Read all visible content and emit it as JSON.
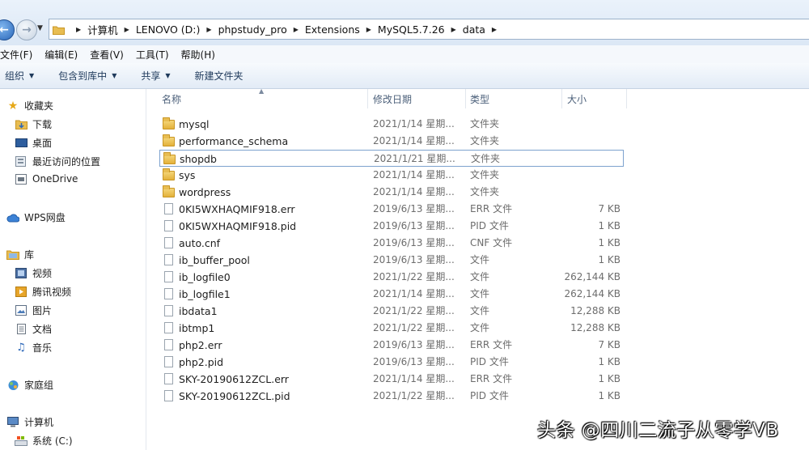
{
  "address": {
    "crumbs": [
      "计算机",
      "LENOVO (D:)",
      "phpstudy_pro",
      "Extensions",
      "MySQL5.7.26",
      "data"
    ]
  },
  "menu": [
    "文件(F)",
    "编辑(E)",
    "查看(V)",
    "工具(T)",
    "帮助(H)"
  ],
  "toolbar": {
    "organize": "组织",
    "include_in_library": "包含到库中",
    "share": "共享",
    "new_folder": "新建文件夹"
  },
  "nav": {
    "favorites": "收藏夹",
    "downloads": "下载",
    "desktop": "桌面",
    "recent": "最近访问的位置",
    "onedrive": "OneDrive",
    "wps": "WPS网盘",
    "libraries": "库",
    "videos": "视频",
    "tencent_video": "腾讯视频",
    "pictures": "图片",
    "documents": "文档",
    "music": "音乐",
    "homegroup": "家庭组",
    "computer": "计算机",
    "system_c": "系统 (C:)"
  },
  "columns": {
    "name": "名称",
    "modified": "修改日期",
    "type": "类型",
    "size": "大小"
  },
  "files": [
    {
      "name": "mysql",
      "date": "2021/1/14 星期...",
      "type": "文件夹",
      "size": "",
      "kind": "folder"
    },
    {
      "name": "performance_schema",
      "date": "2021/1/14 星期...",
      "type": "文件夹",
      "size": "",
      "kind": "folder"
    },
    {
      "name": "shopdb",
      "date": "2021/1/21 星期...",
      "type": "文件夹",
      "size": "",
      "kind": "folder"
    },
    {
      "name": "sys",
      "date": "2021/1/14 星期...",
      "type": "文件夹",
      "size": "",
      "kind": "folder"
    },
    {
      "name": "wordpress",
      "date": "2021/1/14 星期...",
      "type": "文件夹",
      "size": "",
      "kind": "folder"
    },
    {
      "name": "0KI5WXHAQMIF918.err",
      "date": "2019/6/13 星期...",
      "type": "ERR 文件",
      "size": "7 KB",
      "kind": "file"
    },
    {
      "name": "0KI5WXHAQMIF918.pid",
      "date": "2019/6/13 星期...",
      "type": "PID 文件",
      "size": "1 KB",
      "kind": "file"
    },
    {
      "name": "auto.cnf",
      "date": "2019/6/13 星期...",
      "type": "CNF 文件",
      "size": "1 KB",
      "kind": "file"
    },
    {
      "name": "ib_buffer_pool",
      "date": "2019/6/13 星期...",
      "type": "文件",
      "size": "1 KB",
      "kind": "file"
    },
    {
      "name": "ib_logfile0",
      "date": "2021/1/22 星期...",
      "type": "文件",
      "size": "262,144 KB",
      "kind": "file"
    },
    {
      "name": "ib_logfile1",
      "date": "2021/1/14 星期...",
      "type": "文件",
      "size": "262,144 KB",
      "kind": "file"
    },
    {
      "name": "ibdata1",
      "date": "2021/1/22 星期...",
      "type": "文件",
      "size": "12,288 KB",
      "kind": "file"
    },
    {
      "name": "ibtmp1",
      "date": "2021/1/22 星期...",
      "type": "文件",
      "size": "12,288 KB",
      "kind": "file"
    },
    {
      "name": "php2.err",
      "date": "2019/6/13 星期...",
      "type": "ERR 文件",
      "size": "7 KB",
      "kind": "file"
    },
    {
      "name": "php2.pid",
      "date": "2019/6/13 星期...",
      "type": "PID 文件",
      "size": "1 KB",
      "kind": "file"
    },
    {
      "name": "SKY-20190612ZCL.err",
      "date": "2021/1/14 星期...",
      "type": "ERR 文件",
      "size": "1 KB",
      "kind": "file"
    },
    {
      "name": "SKY-20190612ZCL.pid",
      "date": "2021/1/22 星期...",
      "type": "PID 文件",
      "size": "1 KB",
      "kind": "file"
    }
  ],
  "selected_file": "shopdb",
  "watermark": "头条 @四川二流子从零学VB"
}
